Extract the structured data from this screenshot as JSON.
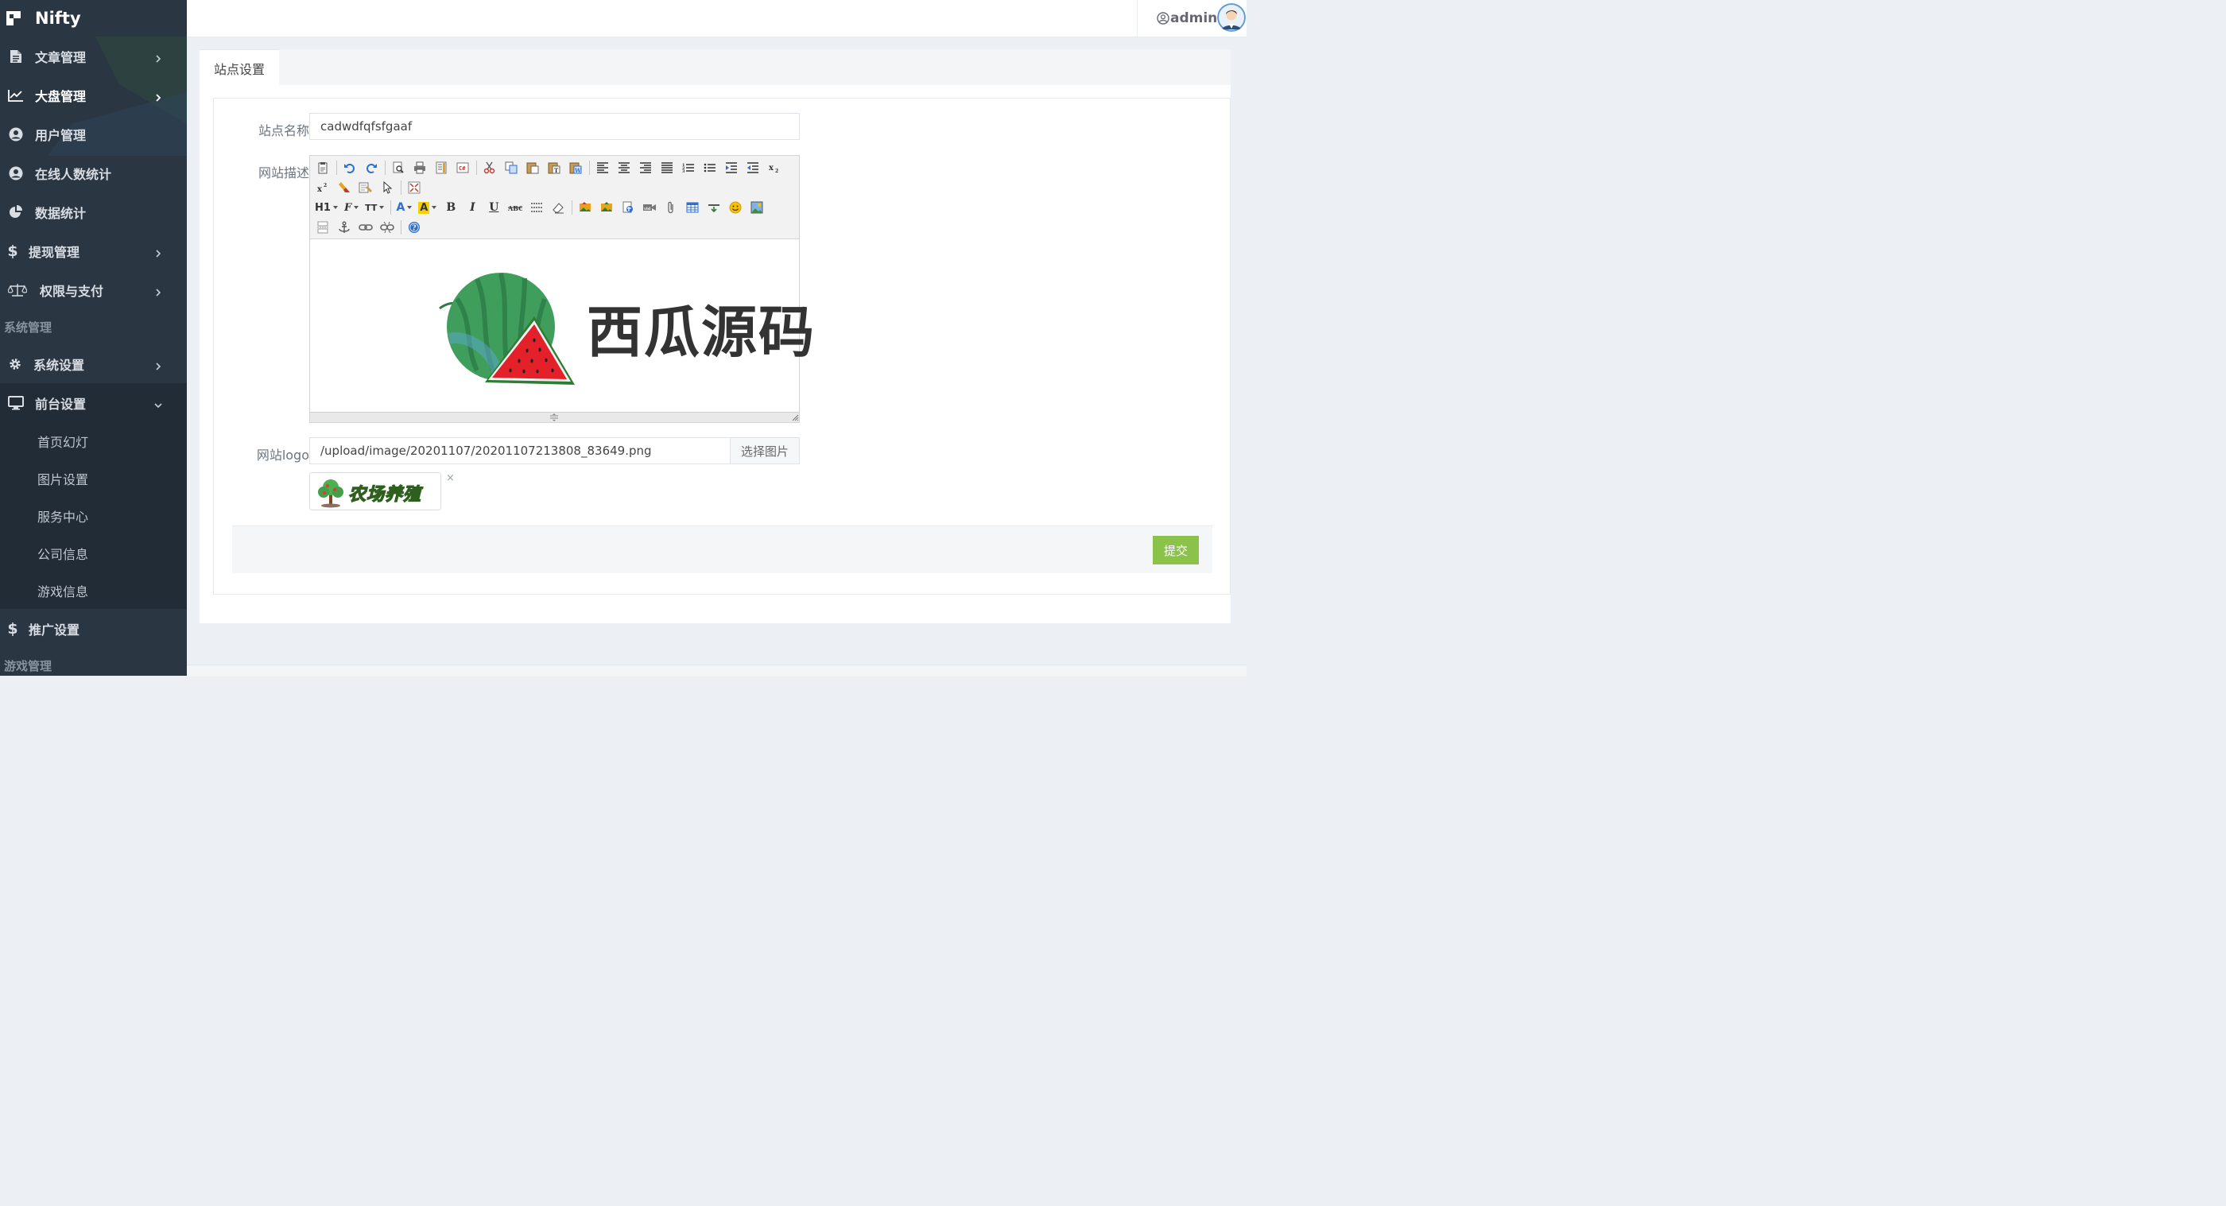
{
  "brand": {
    "name": "Nifty"
  },
  "sidebar": {
    "items": [
      {
        "label": "文章管理",
        "icon": "document-icon",
        "chevron": true
      },
      {
        "label": "大盘管理",
        "icon": "line-chart-icon",
        "chevron": true,
        "active": true
      },
      {
        "label": "用户管理",
        "icon": "user-circle-icon",
        "chevron": false
      },
      {
        "label": "在线人数统计",
        "icon": "user-circle-icon",
        "chevron": false
      },
      {
        "label": "数据统计",
        "icon": "pie-chart-icon",
        "chevron": false
      },
      {
        "label": "提现管理",
        "icon": "dollar-icon",
        "chevron": true
      },
      {
        "label": "权限与支付",
        "icon": "balance-scale-icon",
        "chevron": true
      }
    ],
    "section_system": "系统管理",
    "system_settings": "系统设置",
    "frontend_settings": "前台设置",
    "frontend_sub": [
      "首页幻灯",
      "图片设置",
      "服务中心",
      "公司信息",
      "游戏信息"
    ],
    "promo_settings": "推广设置",
    "section_game": "游戏管理"
  },
  "header": {
    "username": "admin"
  },
  "tabs": [
    {
      "label": "站点设置",
      "active": true
    }
  ],
  "form": {
    "site_name_label": "站点名称",
    "site_name_value": "cadwdfqfsfgaaf",
    "description_label": "网站描述",
    "description_content_text": "西瓜源码",
    "logo_label": "网站logo",
    "logo_path": "/upload/image/20201107/20201107213808_83649.png",
    "choose_image_label": "选择图片",
    "logo_preview_text": "农场养殖",
    "remove_label": "×",
    "submit_label": "提交"
  },
  "editor_toolbar": {
    "row3_dropdowns": [
      "H1",
      "F",
      "TT"
    ]
  },
  "colors": {
    "sidebar_bg": "#2b3643",
    "submit_green": "#8bc34a",
    "watermelon_green": "#3f9e5b",
    "watermelon_red": "#e4202a"
  }
}
